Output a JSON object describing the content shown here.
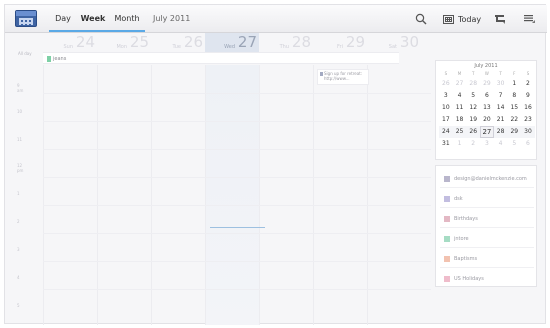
{
  "toolbar": {
    "tabs": [
      {
        "label": "Day"
      },
      {
        "label": "Week"
      },
      {
        "label": "Month"
      }
    ],
    "title": "July 2011",
    "today_label": "Today",
    "icons": [
      "calendar-app-icon",
      "search-icon",
      "today-icon",
      "calendar-select-icon",
      "menu-icon"
    ]
  },
  "allday_label": "All day",
  "days": [
    {
      "name": "Sun",
      "num": "24"
    },
    {
      "name": "Mon",
      "num": "25"
    },
    {
      "name": "Tue",
      "num": "26"
    },
    {
      "name": "Wed",
      "num": "27"
    },
    {
      "name": "Thu",
      "num": "28"
    },
    {
      "name": "Fri",
      "num": "29"
    },
    {
      "name": "Sat",
      "num": "30"
    }
  ],
  "allday_event": {
    "title": "jeans",
    "color": "#7ed0a6"
  },
  "hours": [
    {
      "label": "9\nam"
    },
    {
      "label": "10"
    },
    {
      "label": "11"
    },
    {
      "label": "12\npm"
    },
    {
      "label": "1"
    },
    {
      "label": "2"
    },
    {
      "label": "3"
    },
    {
      "label": "4"
    },
    {
      "label": "5"
    }
  ],
  "event": {
    "line1": "Sign up for retreat:",
    "line2": "http://www...",
    "color": "#a3aac2"
  },
  "mini_month": {
    "title": "July 2011",
    "dow": [
      "S",
      "M",
      "T",
      "W",
      "T",
      "F",
      "S"
    ],
    "weeks": [
      [
        "26",
        "27",
        "28",
        "29",
        "30",
        "1",
        "2"
      ],
      [
        "3",
        "4",
        "5",
        "6",
        "7",
        "8",
        "9"
      ],
      [
        "10",
        "11",
        "12",
        "13",
        "14",
        "15",
        "16"
      ],
      [
        "17",
        "18",
        "19",
        "20",
        "21",
        "22",
        "23"
      ],
      [
        "24",
        "25",
        "26",
        "27",
        "28",
        "29",
        "30"
      ],
      [
        "31",
        "1",
        "2",
        "3",
        "4",
        "5",
        "6"
      ]
    ],
    "today": "27"
  },
  "calendars": [
    {
      "name": "design@danielmckenzie.com",
      "color": "#b9b6cc"
    },
    {
      "name": "dsk",
      "color": "#c2bde0"
    },
    {
      "name": "Birthdays",
      "color": "#e3b8c4"
    },
    {
      "name": "jntore",
      "color": "#a6dcc4"
    },
    {
      "name": "Baptisms",
      "color": "#f2c2b0"
    },
    {
      "name": "US Holidays",
      "color": "#efbccb"
    }
  ],
  "colors": {
    "accent": "#2a8fd8",
    "today_column": "#dfe5ef"
  }
}
